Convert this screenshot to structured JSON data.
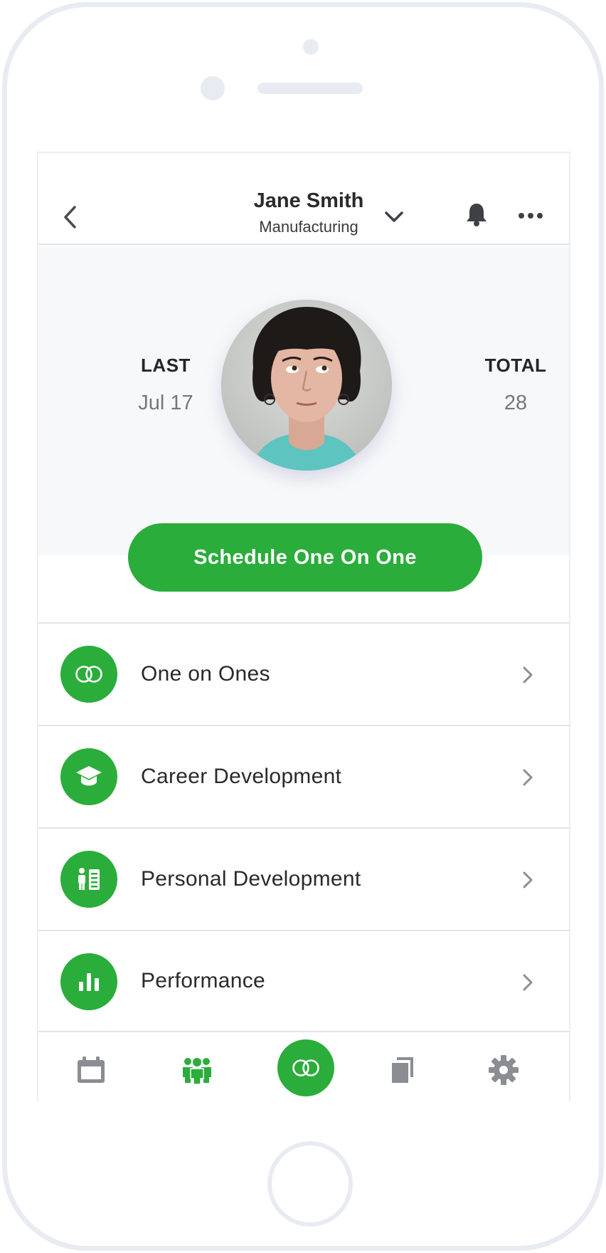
{
  "header": {
    "name": "Jane Smith",
    "department": "Manufacturing"
  },
  "profile": {
    "last_label": "LAST",
    "last_value": "Jul 17",
    "total_label": "TOTAL",
    "total_value": "28"
  },
  "actions": {
    "schedule_label": "Schedule One On One"
  },
  "menu": {
    "items": [
      {
        "label": "One on Ones",
        "icon": "rings-icon"
      },
      {
        "label": "Career Development",
        "icon": "graduation-cap-icon"
      },
      {
        "label": "Personal Development",
        "icon": "person-list-icon"
      },
      {
        "label": "Performance",
        "icon": "bar-chart-icon"
      }
    ]
  },
  "tabbar": {
    "tabs": [
      "calendar-icon",
      "team-icon",
      "rings-icon",
      "documents-icon",
      "gear-icon"
    ],
    "active": "rings-icon"
  },
  "colors": {
    "accent": "#2aad3a",
    "icon_gray": "#8a8d92",
    "frame": "#e8ebf1",
    "header_bg": "#f7f8f9"
  }
}
